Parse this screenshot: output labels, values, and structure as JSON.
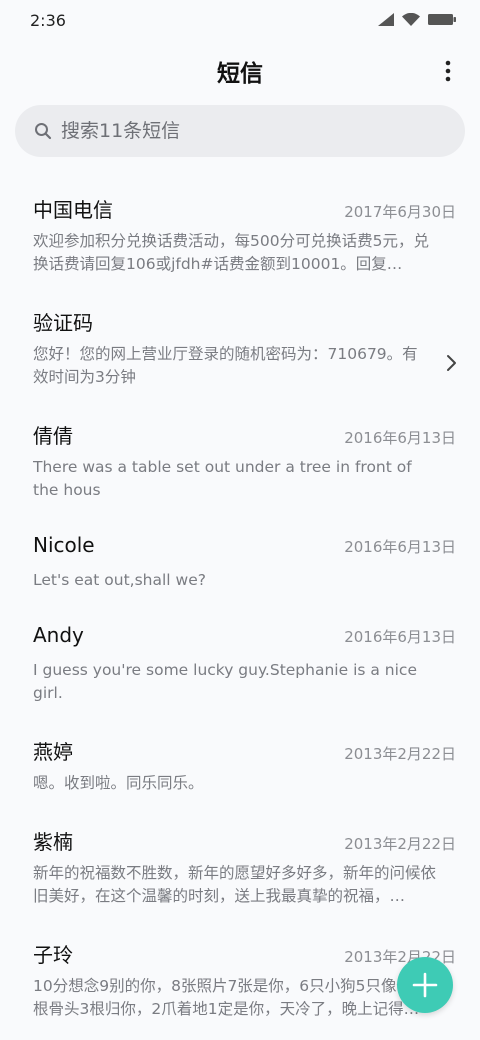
{
  "status_bar": {
    "time": "2:36"
  },
  "header": {
    "title": "短信"
  },
  "search": {
    "placeholder": "搜索11条短信"
  },
  "messages": [
    {
      "sender": "中国电信",
      "date": "2017年6月30日",
      "preview": "欢迎参加积分兑换话费活动，每500分可兑换话费5元，兑换话费请回复106或jfdh#话费金额到10001。回复…"
    },
    {
      "sender": "验证码",
      "date": "",
      "preview": "您好！您的网上营业厅登录的随机密码为：710679。有效时间为3分钟"
    },
    {
      "sender": "倩倩",
      "date": "2016年6月13日",
      "preview": "There was a table set out under a tree in front of the hous"
    },
    {
      "sender": "Nicole",
      "date": "2016年6月13日",
      "preview": "Let's eat out,shall we?"
    },
    {
      "sender": "Andy",
      "date": "2016年6月13日",
      "preview": "I guess you're some lucky guy.Stephanie is a nice girl."
    },
    {
      "sender": "燕婷",
      "date": "2013年2月22日",
      "preview": "嗯。收到啦。同乐同乐。"
    },
    {
      "sender": "紫楠",
      "date": "2013年2月22日",
      "preview": "新年的祝福数不胜数，新年的愿望好多好多，新年的问候依旧美好，在这个温馨的时刻，送上我最真挚的祝福，…"
    },
    {
      "sender": "子玲",
      "date": "2013年2月22日",
      "preview": "10分想念9别的你，8张照片7张是你，6只小狗5只像你，4根骨头3根归你，2爪着地1定是你，天冷了，晚上记得…"
    }
  ],
  "colors": {
    "accent": "#3ecbb5",
    "background": "#f9fafc",
    "search_bg": "#ebecef"
  },
  "icons": {
    "more": "more-vertical-icon",
    "search": "search-icon",
    "fab": "plus-icon",
    "chevron": "chevron-right-icon"
  }
}
